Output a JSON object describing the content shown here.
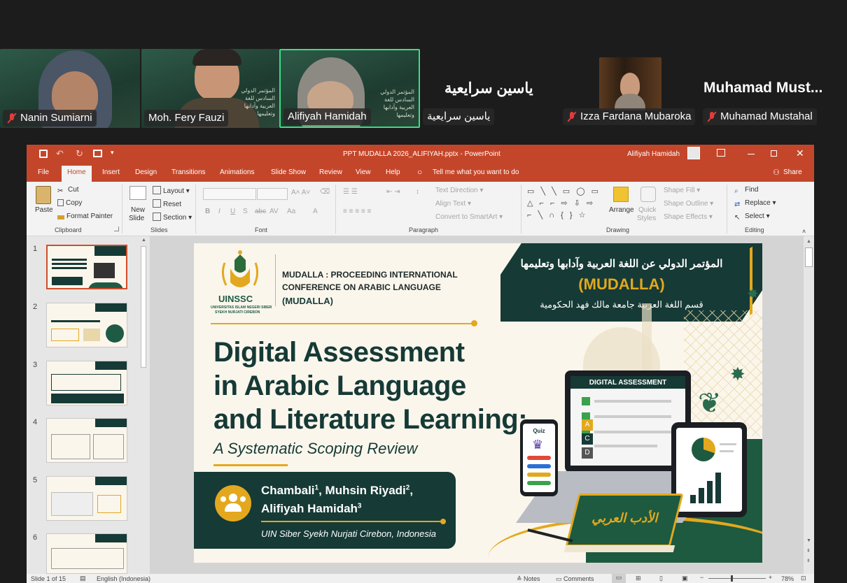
{
  "participants": [
    {
      "name": "Nanin Sumiarni",
      "muted": true
    },
    {
      "name": "Moh. Fery Fauzi",
      "muted": false
    },
    {
      "name": "Alifiyah Hamidah",
      "muted": false,
      "active": true
    },
    {
      "name": "ياسين سرايعية",
      "muted": false,
      "video": false
    },
    {
      "name": "Izza Fardana Mubaroka",
      "muted": true
    },
    {
      "name": "Muhamad Mustahal",
      "muted": true,
      "video": false,
      "display_name": "Muhamad  Must..."
    }
  ],
  "tile_caption_ar": "المؤتمر الدولي السادس للغة العربية وآدابها وتعليمها",
  "window": {
    "title": "PPT MUDALLA 2026_ALIFIYAH.pptx  -  PowerPoint",
    "user": "Alifiyah Hamidah",
    "accent": "#c4462a"
  },
  "ribbon_tabs": [
    "File",
    "Home",
    "Insert",
    "Design",
    "Transitions",
    "Animations",
    "Slide Show",
    "Review",
    "View",
    "Help"
  ],
  "tell_me": "Tell me what you want to do",
  "share": "Share",
  "ribbon": {
    "clipboard": {
      "paste": "Paste",
      "cut": "Cut",
      "copy": "Copy",
      "format_painter": "Format Painter",
      "label": "Clipboard"
    },
    "slides": {
      "new_slide": "New",
      "new_slide2": "Slide",
      "layout": "Layout",
      "reset": "Reset",
      "section": "Section",
      "label": "Slides"
    },
    "font": {
      "label": "Font"
    },
    "paragraph": {
      "text_direction": "Text Direction",
      "align_text": "Align Text",
      "smartart": "Convert to SmartArt",
      "label": "Paragraph"
    },
    "drawing": {
      "arrange": "Arrange",
      "quick": "Quick",
      "styles": "Styles",
      "shape_fill": "Shape Fill",
      "shape_outline": "Shape Outline",
      "shape_effects": "Shape Effects",
      "label": "Drawing"
    },
    "editing": {
      "find": "Find",
      "replace": "Replace",
      "select": "Select",
      "label": "Editing"
    }
  },
  "thumbnails": [
    "1",
    "2",
    "3",
    "4",
    "5",
    "6"
  ],
  "slide": {
    "header_line1": "MUDALLA : PROCEEDING INTERNATIONAL",
    "header_line2": "CONFERENCE ON ARABIC LANGUAGE",
    "header_line3": "(MUDALLA)",
    "logo_text": "UINSSC",
    "logo_sub1": "UNIVERSITAS ISLAM NEGERI SIBER",
    "logo_sub2": "SYEKH NURJATI CIREBON",
    "ar_title": "المؤتمر الدولي عن اللغة العربية وآدابها وتعليمها",
    "ar_mudalla": "(MUDALLA)",
    "ar_sub": "قسم اللغة العربية جامعة مالك فهد الحكومية",
    "title1": "Digital Assessment",
    "title2": "in Arabic Language",
    "title3": "and Literature Learning:",
    "subtitle": "A Systematic Scoping Review",
    "authors_line1_a": "Chambali",
    "sup1": "1",
    "authors_line1_b": ", Muhsin Riyadi",
    "sup2": "2",
    "authors_line1_c": ",",
    "authors_line2": "Alifiyah Hamidah",
    "sup3": "3",
    "affiliation": "UIN Siber Syekh Nurjati Cirebon, Indonesia",
    "screen_title": "DIGITAL ASSESSMENT",
    "quiz": "Quiz",
    "options": [
      "A",
      "C",
      "D"
    ],
    "book_ar": "الأدب العربي"
  },
  "status": {
    "slide": "Slide 1 of 15",
    "language": "English (Indonesia)",
    "notes": "Notes",
    "comments": "Comments",
    "zoom": "78%"
  }
}
